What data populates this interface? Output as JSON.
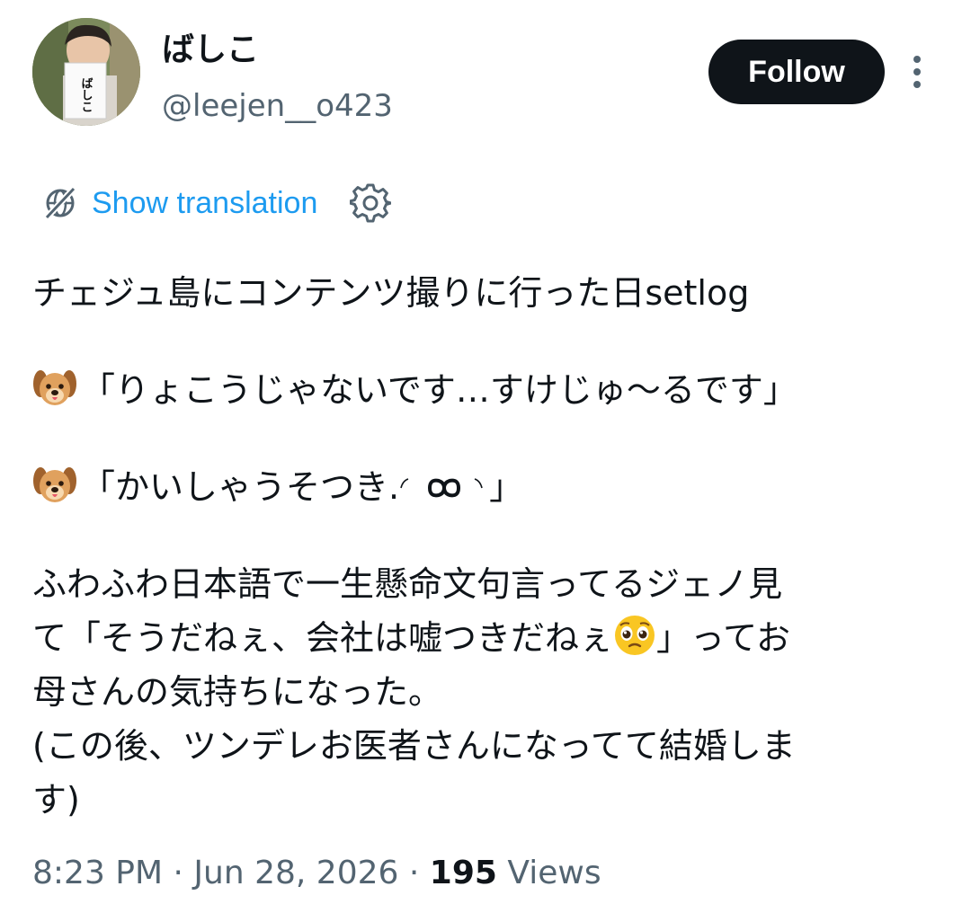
{
  "author": {
    "display_name": "ばしこ",
    "handle": "@leejen__o423",
    "avatar_sign_text": "ばしこ"
  },
  "actions": {
    "follow_label": "Follow"
  },
  "translation": {
    "label": "Show translation"
  },
  "tweet": {
    "line1": "チェジュ島にコンテンツ撮りに行った日setlog",
    "quote1_text": "「りょこうじゃないです…すけじゅ〜るです」",
    "quote2_text": "「かいしゃうそつき.",
    "quote2_close": "」",
    "para_line1": "ふわふわ日本語で一生懸命文句言ってるジェノ見",
    "para_line2_a": "て「そうだねぇ、会社は嘘つきだねぇ",
    "para_line2_b": "」ってお",
    "para_line3": "母さんの気持ちになった。",
    "para_line4": "(この後、ツンデレお医者さんになってて結婚しま",
    "para_line5": "す)"
  },
  "meta": {
    "time": "8:23 PM",
    "separator": "·",
    "date": "Jun 28, 2026",
    "views_count": "195",
    "views_label": "Views"
  },
  "icons": {
    "more": "more-vertical-icon",
    "globe": "globe-slash-icon",
    "gear": "gear-icon",
    "dog": "dog-face-emoji",
    "pleading": "pleading-face-emoji"
  },
  "colors": {
    "link": "#1d9bf0",
    "secondary_text": "#536471",
    "primary_text": "#0f1419",
    "follow_bg": "#0f1419"
  }
}
